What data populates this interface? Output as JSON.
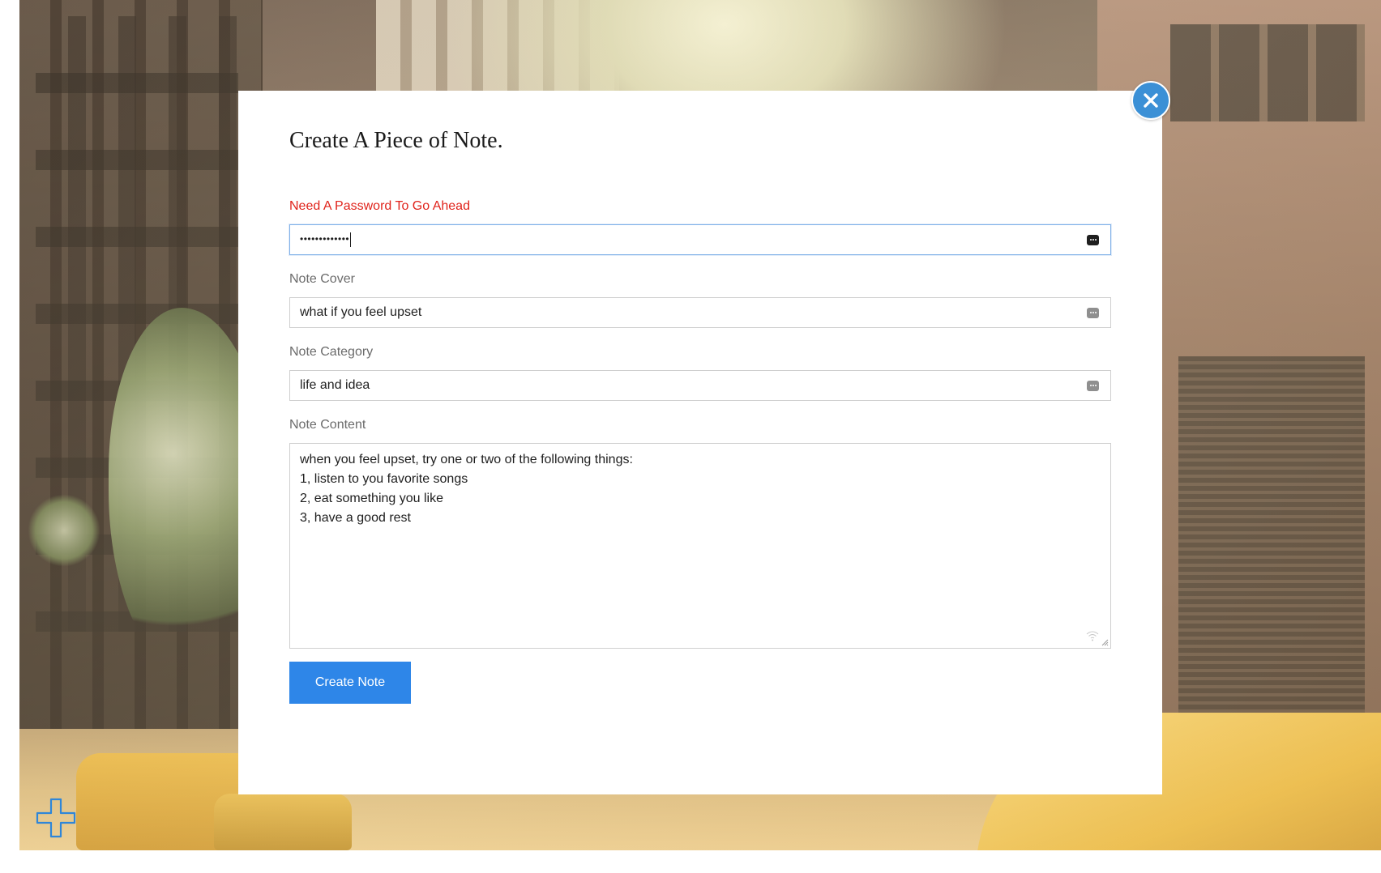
{
  "modal": {
    "title": "Create A Piece of Note.",
    "close_icon": "close-x-icon",
    "password_field": {
      "label": "Need A Password To Go Ahead",
      "label_color": "#e0231b",
      "masked_value": "•••••••••••••",
      "icon": "password-manager-icon",
      "focused": true
    },
    "cover_field": {
      "label": "Note Cover",
      "value": "what if you feel upset",
      "icon": "password-manager-icon"
    },
    "category_field": {
      "label": "Note Category",
      "value": "life and idea",
      "icon": "password-manager-icon"
    },
    "content_field": {
      "label": "Note Content",
      "lines": [
        "when you feel upset, try one or two of the following things:",
        "1, listen to you favorite songs",
        "2, eat something you like",
        "3, have a good rest"
      ],
      "icon": "wifi-icon"
    },
    "submit_label": "Create Note"
  },
  "floating_action": {
    "icon": "add-note-plus-icon"
  },
  "colors": {
    "accent": "#2e86e8",
    "close_button": "#3b90d6",
    "error_text": "#e0231b",
    "focus_border": "#7fb0e8"
  }
}
